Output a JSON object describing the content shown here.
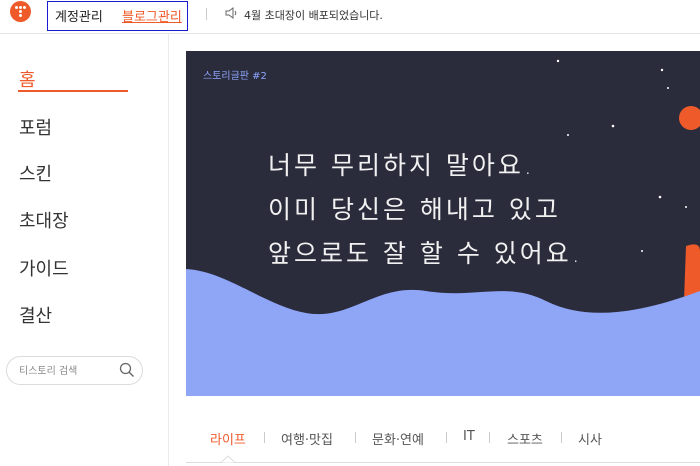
{
  "header": {
    "account_label": "계정관리",
    "blog_label": "블로그관리",
    "notice": "4월 초대장이 배포되었습니다."
  },
  "sidebar": {
    "items": [
      {
        "label": "홈",
        "active": true
      },
      {
        "label": "포럼",
        "active": false
      },
      {
        "label": "스킨",
        "active": false
      },
      {
        "label": "초대장",
        "active": false
      },
      {
        "label": "가이드",
        "active": false
      },
      {
        "label": "결산",
        "active": false
      }
    ],
    "search_placeholder": "티스토리 검색"
  },
  "banner": {
    "label": "스토리글판 #2",
    "lines": [
      "너무 무리하지 말아요.",
      "이미 당신은 해내고 있고",
      "앞으로도 잘 할 수 있어요."
    ]
  },
  "tabs": [
    {
      "label": "라이프",
      "active": true
    },
    {
      "label": "여행·맛집",
      "active": false
    },
    {
      "label": "문화·연예",
      "active": false
    },
    {
      "label": "IT",
      "active": false
    },
    {
      "label": "스포츠",
      "active": false
    },
    {
      "label": "시사",
      "active": false
    }
  ],
  "colors": {
    "accent": "#ef5a2a",
    "banner_bg": "#2a2b3b",
    "banner_wave": "#8fa6f7",
    "highlight_border": "#1b1bd6"
  },
  "icons": {
    "logo": "tistory-logo-icon",
    "notice": "speaker-icon",
    "search": "search-icon"
  }
}
